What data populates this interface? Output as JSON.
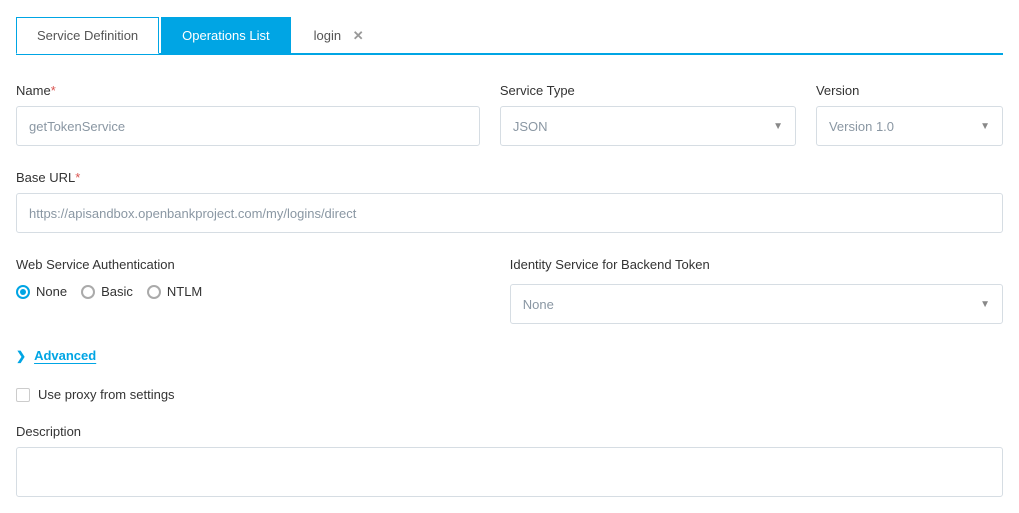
{
  "tabs": {
    "service_definition": "Service Definition",
    "operations_list": "Operations List",
    "login": "login"
  },
  "fields": {
    "name_label": "Name",
    "name_value": "getTokenService",
    "service_type_label": "Service Type",
    "service_type_value": "JSON",
    "version_label": "Version",
    "version_value": "Version 1.0",
    "base_url_label": "Base URL",
    "base_url_value": "https://apisandbox.openbankproject.com/my/logins/direct",
    "auth_label": "Web Service Authentication",
    "auth_options": {
      "none": "None",
      "basic": "Basic",
      "ntlm": "NTLM"
    },
    "auth_selected": "none",
    "identity_label": "Identity Service for Backend Token",
    "identity_value": "None",
    "advanced_label": "Advanced",
    "proxy_label": "Use proxy from settings",
    "proxy_checked": false,
    "description_label": "Description",
    "description_value": ""
  }
}
